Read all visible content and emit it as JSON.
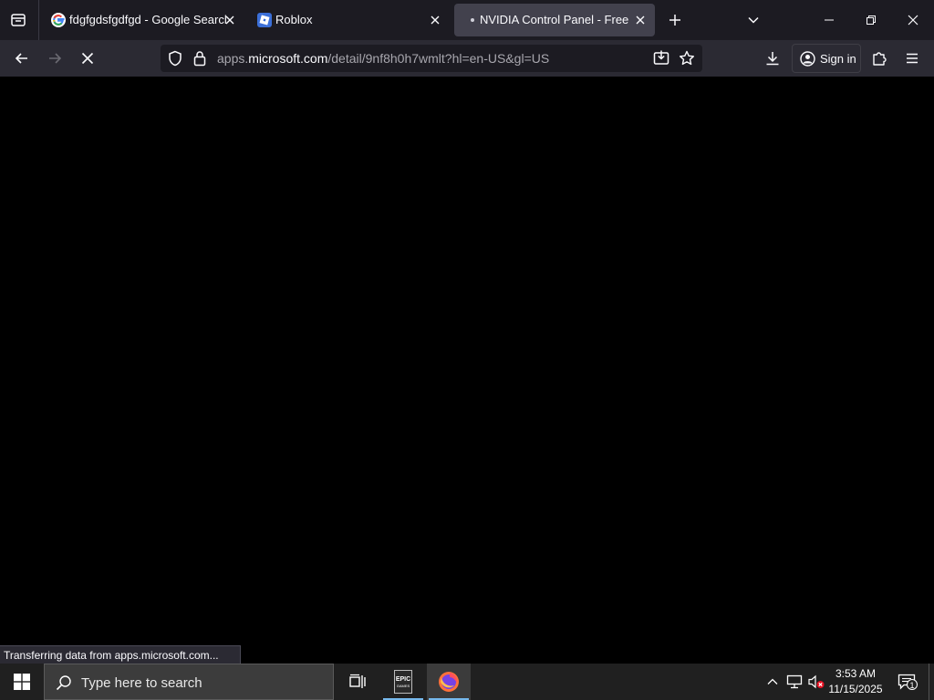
{
  "browser": {
    "tabs": [
      {
        "title": "fdgfgdsfgdfgd - Google Search",
        "favicon": "google-g-icon",
        "active": false
      },
      {
        "title": "Roblox",
        "favicon": "roblox-icon",
        "active": false
      },
      {
        "title": "NVIDIA Control Panel - Free download",
        "favicon": "loading-dot-icon",
        "active": true
      }
    ],
    "url": {
      "prefix": "apps.",
      "host": "microsoft.com",
      "path": "/detail/9nf8h0h7wmlt?hl=en-US&gl=US"
    },
    "sign_in_label": "Sign in",
    "status_text": "Transferring data from apps.microsoft.com..."
  },
  "taskbar": {
    "search_placeholder": "Type here to search",
    "apps": [
      "task-view-icon",
      "epic-games-icon",
      "firefox-icon"
    ],
    "epic_label_top": "EPIC",
    "epic_label_bottom": "GAMES",
    "clock_time": "3:53 AM",
    "clock_date": "11/15/2025",
    "notification_count": "1"
  },
  "colors": {
    "tabbar_bg": "#1c1b22",
    "navbar_bg": "#2b2a33",
    "active_tab_bg": "#42414d",
    "content_bg": "#000000",
    "taskbar_bg": "#202020",
    "accent": "#76b9ed"
  }
}
